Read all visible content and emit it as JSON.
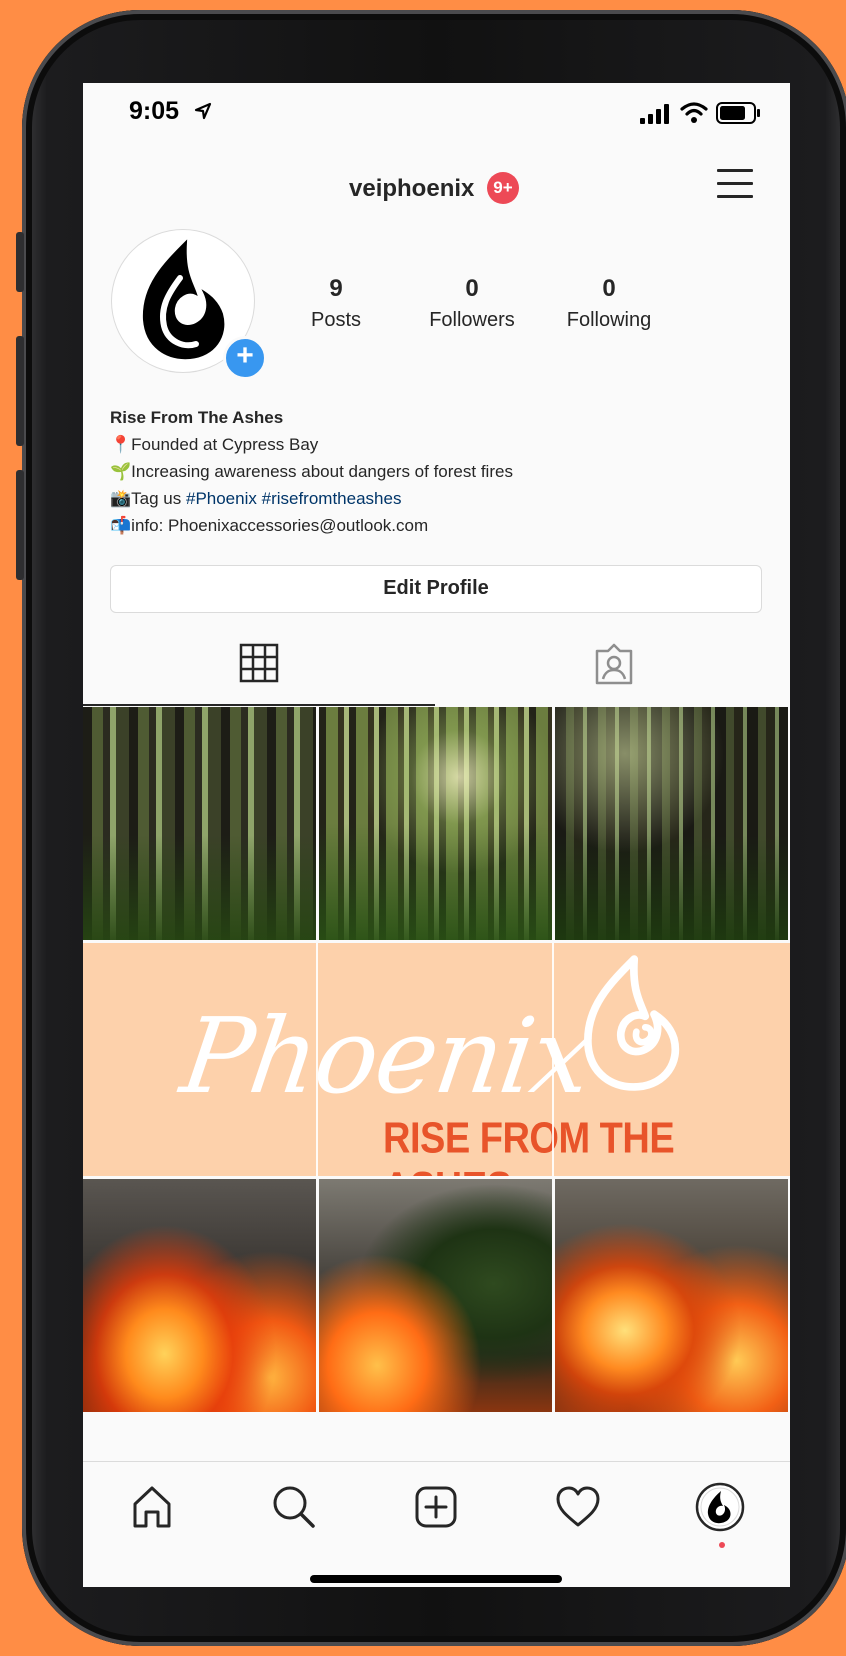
{
  "status_bar": {
    "time": "9:05"
  },
  "header": {
    "username": "veiphoenix",
    "notification_badge": "9+"
  },
  "profile": {
    "stats": [
      {
        "value": "9",
        "label": "Posts"
      },
      {
        "value": "0",
        "label": "Followers"
      },
      {
        "value": "0",
        "label": "Following"
      }
    ],
    "bio": {
      "name": "Rise From The Ashes",
      "line1_emoji": "📍",
      "line1_text": "Founded at Cypress Bay",
      "line2_emoji": "🌱",
      "line2_text": "Increasing awareness about dangers of forest fires",
      "line3_emoji": "📸",
      "line3_prefix": "Tag us ",
      "line3_hashtag1": "#Phoenix",
      "line3_hashtag2": "#risefromtheashes",
      "line4_emoji": "📬",
      "line4_text": "info: Phoenixaccessories@outlook.com"
    },
    "edit_button": "Edit Profile"
  },
  "tabs": {
    "active": "grid",
    "items": [
      "grid-icon",
      "tagged-icon"
    ]
  },
  "grid": {
    "banner_word": "Phoenix",
    "banner_tagline": "RISE FROM THE ASHES",
    "rows": [
      [
        "forest",
        "forest",
        "forest"
      ],
      [
        "banner",
        "banner",
        "banner"
      ],
      [
        "fire",
        "fire",
        "fire"
      ]
    ]
  },
  "bottom_nav": {
    "items": [
      "home-icon",
      "search-icon",
      "new-post-icon",
      "activity-heart-icon",
      "profile-avatar-icon"
    ],
    "active": "profile-avatar-icon"
  },
  "colors": {
    "background": "#ff8d45",
    "badge": "#ed4956",
    "add_story": "#3897f0",
    "hashtag": "#003569",
    "banner_bg": "#fdd1ab",
    "banner_tagline": "#e8542a"
  }
}
